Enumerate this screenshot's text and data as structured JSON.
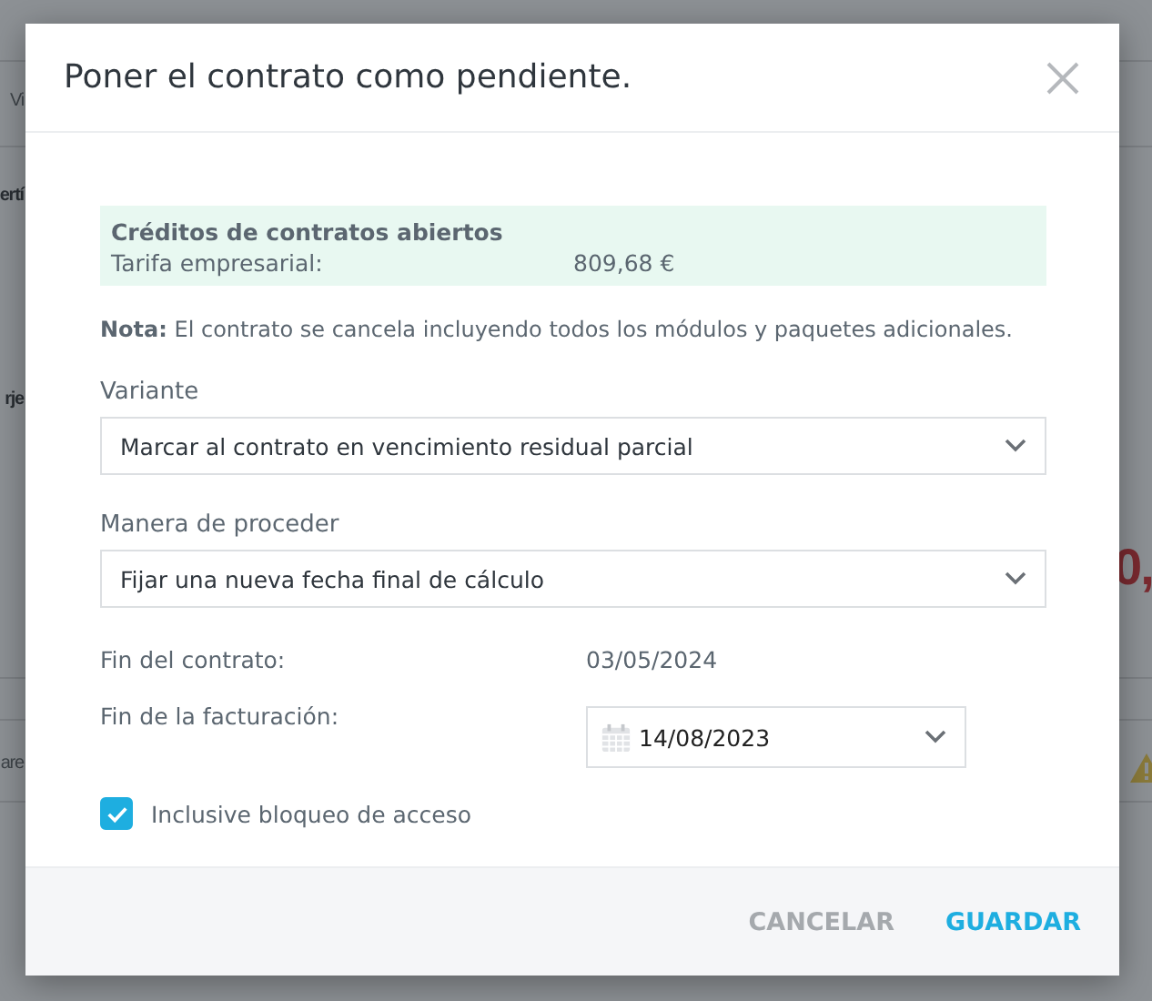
{
  "background": {
    "fragments": [
      {
        "text": "Vi",
        "kind": "plain"
      },
      {
        "text": "ertí",
        "kind": "bold"
      },
      {
        "text": "rje",
        "kind": "bold"
      },
      {
        "text": "are",
        "kind": "plain"
      },
      {
        "text": "0,",
        "kind": "amount"
      }
    ]
  },
  "dialog": {
    "title": "Poner el contrato como pendiente.",
    "credits": {
      "heading": "Créditos de contratos abiertos",
      "label": "Tarifa empresarial:",
      "value": "809,68 €"
    },
    "note": "**Nota:** El contrato se cancela incluyendo todos los módulos y paquetes adicionales.",
    "variant": {
      "label": "Variante",
      "value": "Marcar al contrato en vencimiento residual parcial"
    },
    "procedure": {
      "label": "Manera de proceder",
      "value": "Fijar una nueva fecha final de cálculo"
    },
    "contract_end": {
      "label": "Fin del contrato:",
      "value": "03/05/2024"
    },
    "billing_end": {
      "label": "Fin de la facturación:",
      "value": "14/08/2023"
    },
    "access_block": {
      "label": "Inclusive bloqueo de acceso",
      "checked": true
    },
    "buttons": [
      {
        "label": "CANCELAR",
        "kind": "secondary"
      },
      {
        "label": "GUARDAR",
        "kind": "primary"
      }
    ]
  }
}
